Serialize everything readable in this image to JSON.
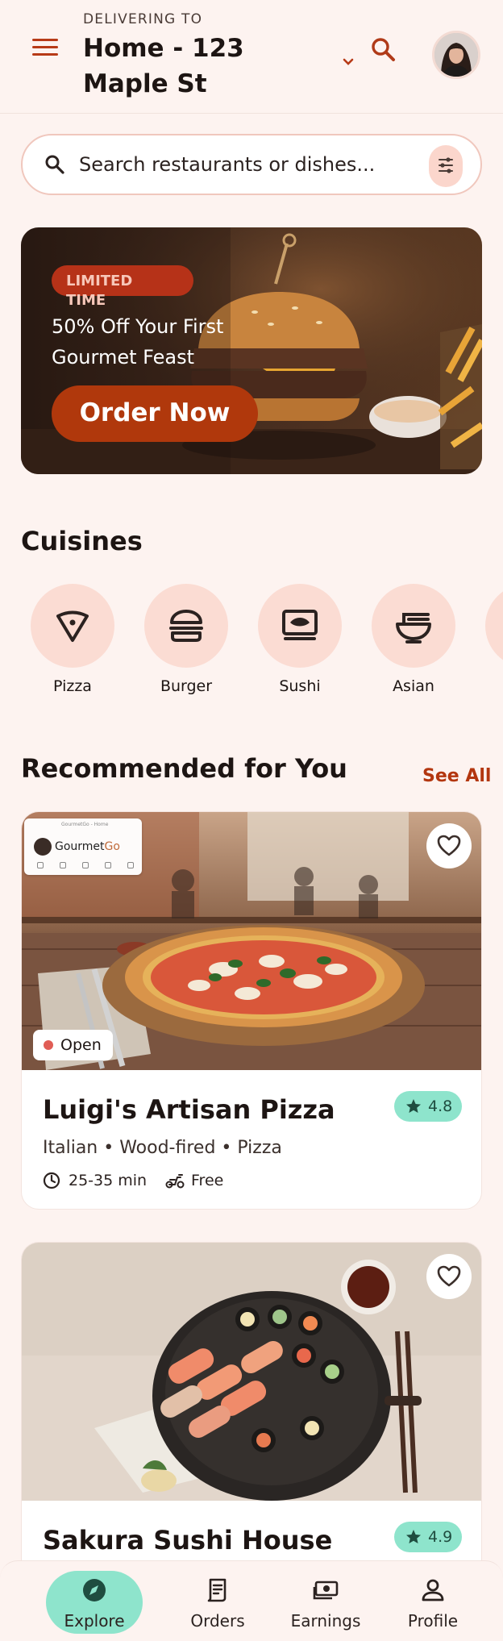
{
  "header": {
    "delivering_label": "DELIVERING TO",
    "address": "Home - 123 Maple St"
  },
  "search": {
    "placeholder": "Search restaurants or dishes..."
  },
  "promo": {
    "tag": "LIMITED TIME",
    "title": "50% Off Your First Gourmet Feast",
    "cta": "Order Now"
  },
  "cuisines": {
    "title": "Cuisines",
    "items": [
      {
        "label": "Pizza",
        "icon": "pizza-icon"
      },
      {
        "label": "Burger",
        "icon": "burger-icon"
      },
      {
        "label": "Sushi",
        "icon": "sushi-icon"
      },
      {
        "label": "Asian",
        "icon": "noodle-bowl-icon"
      }
    ]
  },
  "recommended": {
    "title": "Recommended for You",
    "see_all": "See All",
    "restaurants": [
      {
        "name": "Luigi's Artisan Pizza",
        "rating": "4.8",
        "tags": "Italian • Wood-fired • Pizza",
        "time": "25-35 min",
        "delivery": "Free",
        "status": "Open",
        "overlay": {
          "window_title": "GourmetGo - Home",
          "brand_a": "Gourmet",
          "brand_b": "Go"
        }
      },
      {
        "name": "Sakura Sushi House",
        "rating": "4.9"
      }
    ]
  },
  "nav": {
    "items": [
      {
        "label": "Explore",
        "icon": "compass-icon",
        "active": true
      },
      {
        "label": "Orders",
        "icon": "receipt-icon",
        "active": false
      },
      {
        "label": "Earnings",
        "icon": "money-icon",
        "active": false
      },
      {
        "label": "Profile",
        "icon": "person-icon",
        "active": false
      }
    ]
  },
  "colors": {
    "background": "#fdf3f0",
    "accent": "#b3360f",
    "rating_bg": "#8ee4cc",
    "cuisine_bg": "#fbdcd3"
  }
}
